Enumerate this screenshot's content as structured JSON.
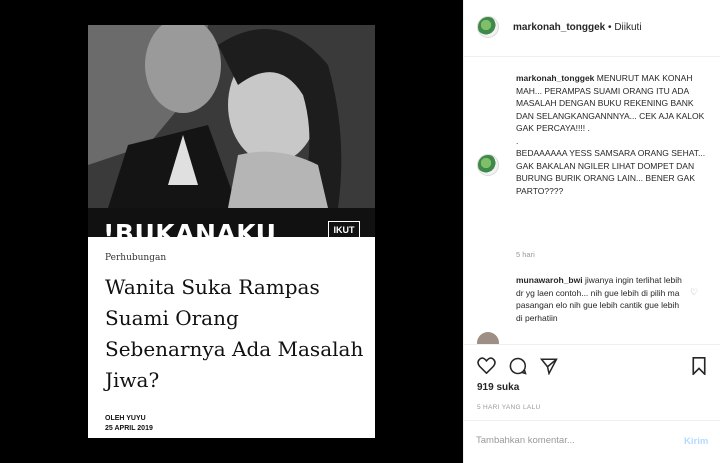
{
  "post": {
    "brand_name": "!BUKANAKU",
    "follow_badge": "IKUT",
    "category": "Perhubungan",
    "headline": "Wanita Suka Rampas Suami Orang Sebenarnya Ada Masalah Jiwa?",
    "byline_author": "OLEH YUYU",
    "byline_date": "25 APRIL 2019"
  },
  "header": {
    "username": "markonah_tonggek",
    "separator": "•",
    "follow_status": "Diikuti",
    "avatar_icon": "tree-avatar-icon"
  },
  "comments": [
    {
      "username": "markonah_tonggek",
      "text": "MENURUT MAK KONAH MAH... PERAMPAS SUAMI ORANG ITU ADA MASALAH DENGAN BUKU REKENING BANK DAN SELANGKANGANNNYA... CEK AJA KALOK GAK PERCAYA!!!! .",
      "text2": ".",
      "text3": "BEDAAAAAA YESS SAMSARA ORANG SEHAT... GAK BAKALAN NGILER LIHAT DOMPET DAN BURUNG BURIK ORANG LAIN... BENER GAK PARTO????",
      "time": "5 hari"
    },
    {
      "username": "munawaroh_bwi",
      "text": "jiwanya ingin terlihat lebih dr yg laen contoh... nih gue lebih di pilih ma pasangan elo nih gue lebih cantik gue lebih di perhatiin"
    }
  ],
  "actions": {
    "like_icon": "heart-icon",
    "comment_icon": "comment-icon",
    "share_icon": "share-icon",
    "save_icon": "bookmark-icon",
    "likes": "919 suka",
    "posted": "5 HARI YANG LALU"
  },
  "add_comment": {
    "placeholder": "Tambahkan komentar...",
    "post_label": "Kirim"
  }
}
